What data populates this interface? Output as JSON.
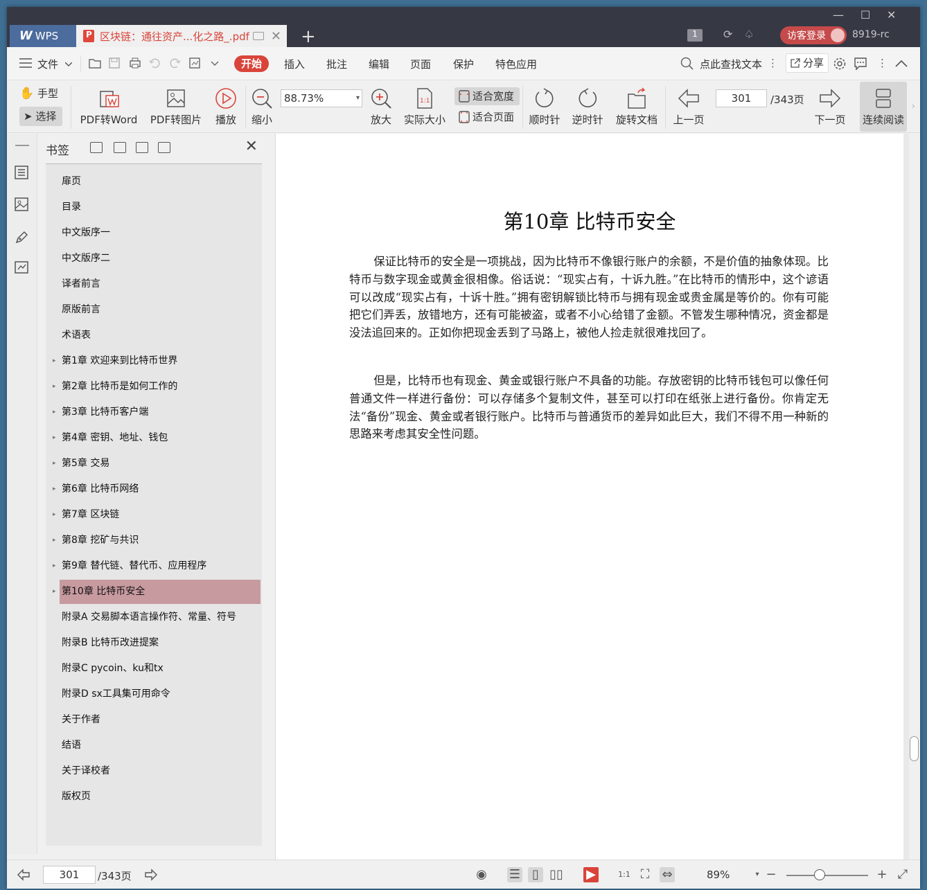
{
  "titlebar": {
    "app_tab": "WPS",
    "doc_tab_title": "区块链：通往资产...化之路_.pdf",
    "tab_count": "1",
    "login": "访客登录",
    "user": "8919-rc"
  },
  "menu": {
    "file": "文件",
    "start": "开始",
    "items": [
      "插入",
      "批注",
      "编辑",
      "页面",
      "保护",
      "特色应用"
    ],
    "search": "点此查找文本",
    "share": "分享"
  },
  "ribbon": {
    "hand": "手型",
    "select": "选择",
    "pdf_to_word": "PDF转Word",
    "pdf_to_image": "PDF转图片",
    "play": "播放",
    "zoom_out": "缩小",
    "zoom_value": "88.73%",
    "zoom_in": "放大",
    "actual_size": "实际大小",
    "fit_width": "适合宽度",
    "fit_page": "适合页面",
    "rotate_cw": "顺时针",
    "rotate_ccw": "逆时针",
    "rotate_doc": "旋转文档",
    "prev_page": "上一页",
    "page_current": "301",
    "page_total": "/343页",
    "next_page": "下一页",
    "continuous": "连续阅读"
  },
  "bookmarks": {
    "title": "书签",
    "items": [
      {
        "label": "扉页",
        "expandable": false
      },
      {
        "label": "目录",
        "expandable": false
      },
      {
        "label": "中文版序一",
        "expandable": false
      },
      {
        "label": "中文版序二",
        "expandable": false
      },
      {
        "label": "译者前言",
        "expandable": false
      },
      {
        "label": "原版前言",
        "expandable": false
      },
      {
        "label": "术语表",
        "expandable": false
      },
      {
        "label": "第1章 欢迎来到比特币世界",
        "expandable": true
      },
      {
        "label": "第2章 比特币是如何工作的",
        "expandable": true
      },
      {
        "label": "第3章 比特币客户端",
        "expandable": true
      },
      {
        "label": "第4章 密钥、地址、钱包",
        "expandable": true
      },
      {
        "label": "第5章 交易",
        "expandable": true
      },
      {
        "label": "第6章 比特币网络",
        "expandable": true
      },
      {
        "label": "第7章 区块链",
        "expandable": true
      },
      {
        "label": "第8章 挖矿与共识",
        "expandable": true
      },
      {
        "label": "第9章 替代链、替代币、应用程序",
        "expandable": true
      },
      {
        "label": "第10章 比特币安全",
        "expandable": true,
        "active": true
      },
      {
        "label": "附录A 交易脚本语言操作符、常量、符号",
        "expandable": false
      },
      {
        "label": "附录B 比特币改进提案",
        "expandable": false
      },
      {
        "label": "附录C pycoin、ku和tx",
        "expandable": false
      },
      {
        "label": "附录D sx工具集可用命令",
        "expandable": false
      },
      {
        "label": "关于作者",
        "expandable": false
      },
      {
        "label": "结语",
        "expandable": false
      },
      {
        "label": "关于译校者",
        "expandable": false
      },
      {
        "label": "版权页",
        "expandable": false
      }
    ]
  },
  "document": {
    "chapter_title": "第10章 比特币安全",
    "paragraphs": [
      "保证比特币的安全是一项挑战，因为比特币不像银行账户的余额，不是价值的抽象体现。比特币与数字现金或黄金很相像。俗话说：“现实占有，十诉九胜。”在比特币的情形中，这个谚语可以改成“现实占有，十诉十胜。”拥有密钥解锁比特币与拥有现金或贵金属是等价的。你有可能把它们弄丢，放错地方，还有可能被盗，或者不小心给错了金额。不管发生哪种情况，资金都是没法追回来的。正如你把现金丢到了马路上，被他人捡走就很难找回了。",
      "但是，比特币也有现金、黄金或银行账户不具备的功能。存放密钥的比特币钱包可以像任何普通文件一样进行备份：可以存储多个复制文件，甚至可以打印在纸张上进行备份。你肯定无法“备份”现金、黄金或者银行账户。比特币与普通货币的差异如此巨大，我们不得不用一种新的思路来考虑其安全性问题。"
    ]
  },
  "statusbar": {
    "page_current": "301",
    "page_total": "/343页",
    "zoom": "89%",
    "zoom_level_fraction": 0.41
  }
}
